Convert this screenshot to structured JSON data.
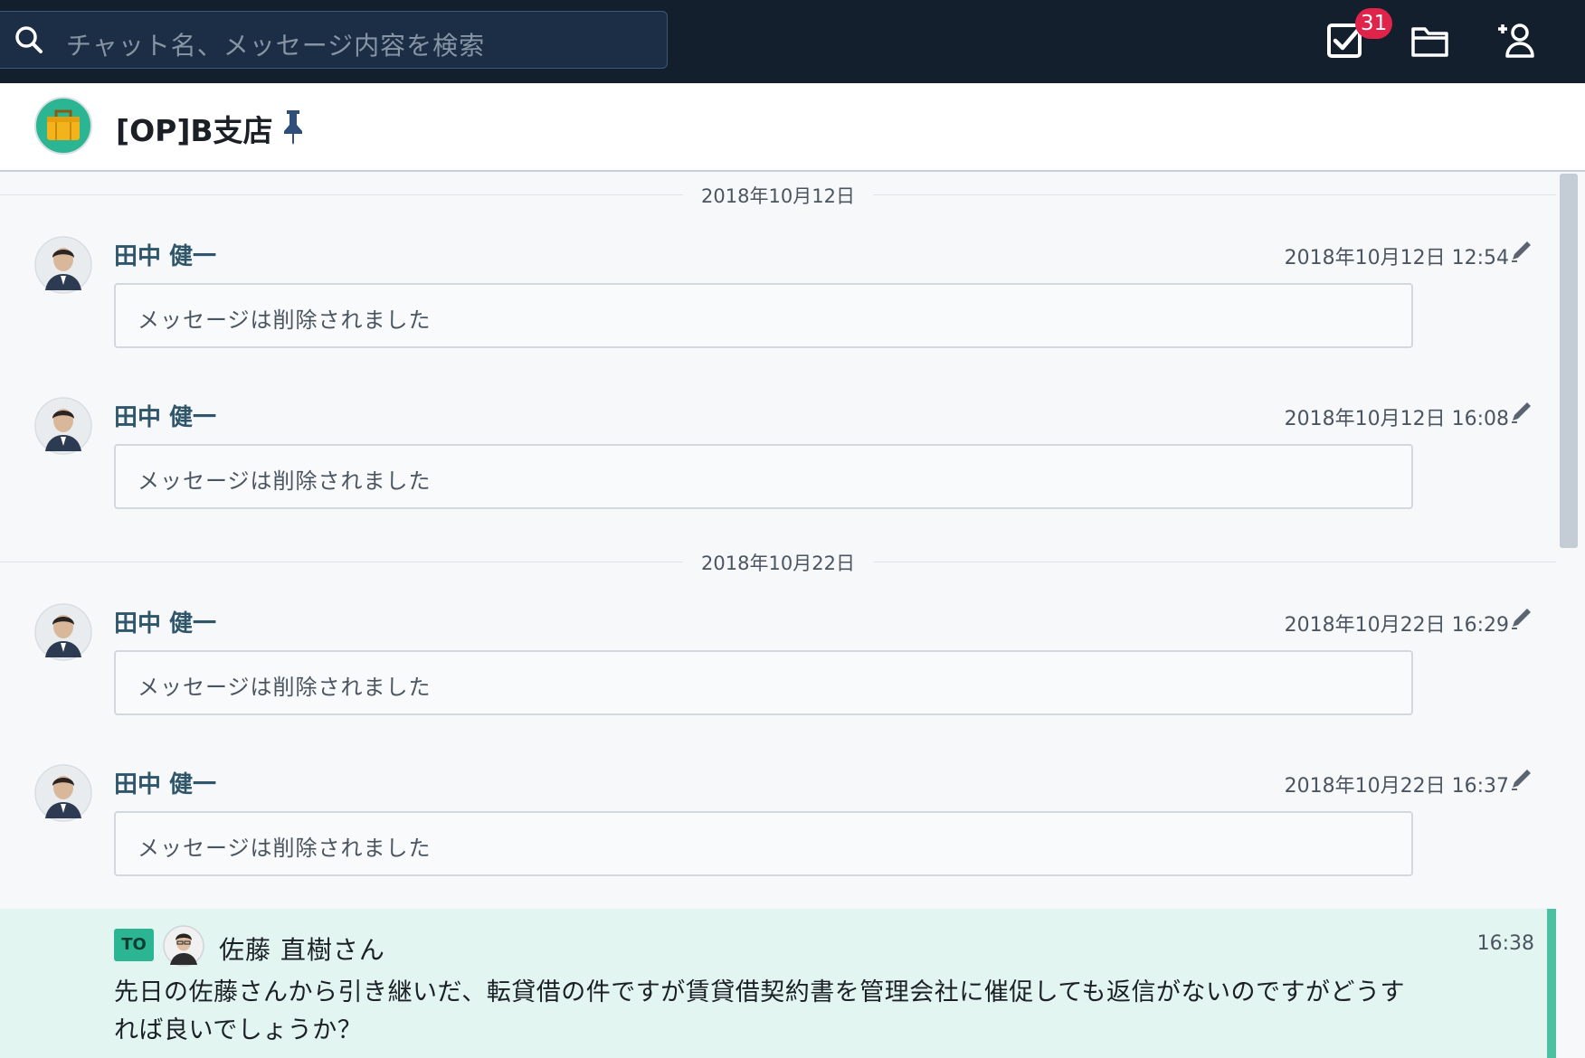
{
  "search": {
    "placeholder": "チャット名、メッセージ内容を検索"
  },
  "toolbar": {
    "task_badge": "31"
  },
  "room": {
    "title": "[OP]B支店"
  },
  "dates": [
    "2018年10月12日",
    "2018年10月22日"
  ],
  "messages": [
    {
      "sender": "田中 健一",
      "timestamp": "2018年10月12日 12:54",
      "body": "メッセージは削除されました"
    },
    {
      "sender": "田中 健一",
      "timestamp": "2018年10月12日 16:08",
      "body": "メッセージは削除されました"
    },
    {
      "sender": "田中 健一",
      "timestamp": "2018年10月22日 16:29",
      "body": "メッセージは削除されました"
    },
    {
      "sender": "田中 健一",
      "timestamp": "2018年10月22日 16:37",
      "body": "メッセージは削除されました"
    }
  ],
  "highlight": {
    "to_label": "TO",
    "to_name": "佐藤 直樹さん",
    "time": "16:38",
    "body": "先日の佐藤さんから引き継いだ、転貸借の件ですが賃貸借契約書を管理会社に催促しても返信がないのですがどうすれば良いでしょうか？"
  },
  "colors": {
    "topbar": "#141f2e",
    "badge": "#e0234b",
    "to_tag": "#2bb592",
    "highlight_bg": "#e3f5f1",
    "sender": "#2f566b"
  },
  "icons": [
    "search-icon",
    "task-check-icon",
    "folder-icon",
    "add-contact-icon",
    "pin-icon",
    "edit-pencil-icon"
  ]
}
